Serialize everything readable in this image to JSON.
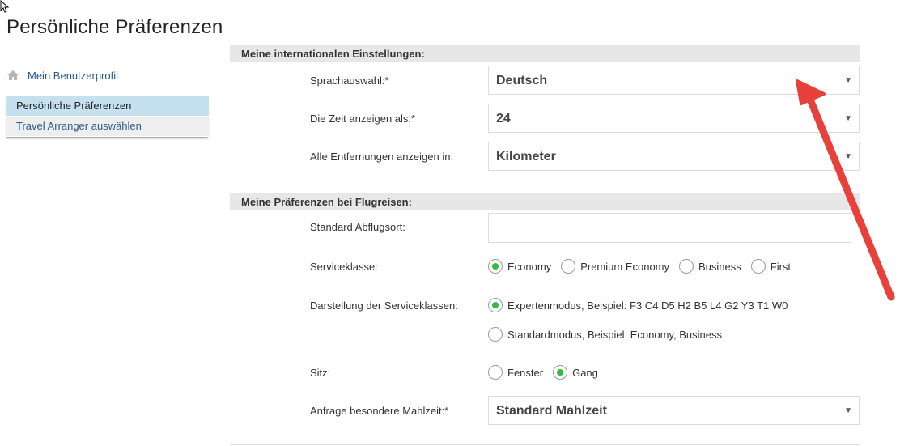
{
  "page": {
    "title": "Persönliche Präferenzen"
  },
  "sidebar": {
    "profile_link": "Mein Benutzerprofil",
    "items": [
      {
        "label": "Persönliche Präferenzen",
        "active": true
      },
      {
        "label": "Travel Arranger auswählen",
        "active": false
      }
    ]
  },
  "international": {
    "header": "Meine internationalen Einstellungen:",
    "language_label": "Sprachauswahl:*",
    "language_value": "Deutsch",
    "time_label": "Die Zeit anzeigen als:*",
    "time_value": "24",
    "distance_label": "Alle Entfernungen anzeigen in:",
    "distance_value": "Kilometer"
  },
  "flight": {
    "header": "Meine Präferenzen bei Flugreisen:",
    "departure_label": "Standard Abflugsort:",
    "departure_value": "",
    "service_class_label": "Serviceklasse:",
    "service_class_options": [
      "Economy",
      "Premium Economy",
      "Business",
      "First"
    ],
    "service_class_selected": "Economy",
    "display_label": "Darstellung der Serviceklassen:",
    "display_options": [
      "Expertenmodus, Beispiel: F3 C4 D5 H2 B5 L4 G2 Y3 T1 W0",
      "Standardmodus, Beispiel: Economy, Business"
    ],
    "display_selected": "Expertenmodus, Beispiel: F3 C4 D5 H2 B5 L4 G2 Y3 T1 W0",
    "seat_label": "Sitz:",
    "seat_options": [
      "Fenster",
      "Gang"
    ],
    "seat_selected": "Gang",
    "meal_label": "Anfrage besondere Mahlzeit:*",
    "meal_value": "Standard Mahlzeit"
  },
  "colors": {
    "accent_radio": "#2fbf3a",
    "annotation_arrow": "#e8413b",
    "sidebar_active": "#c5e1ef",
    "link": "#2a5a8a"
  },
  "icons": {
    "profile": "home-icon",
    "dropdown": "caret-down-icon",
    "annotation": "red-arrow-annotation"
  }
}
